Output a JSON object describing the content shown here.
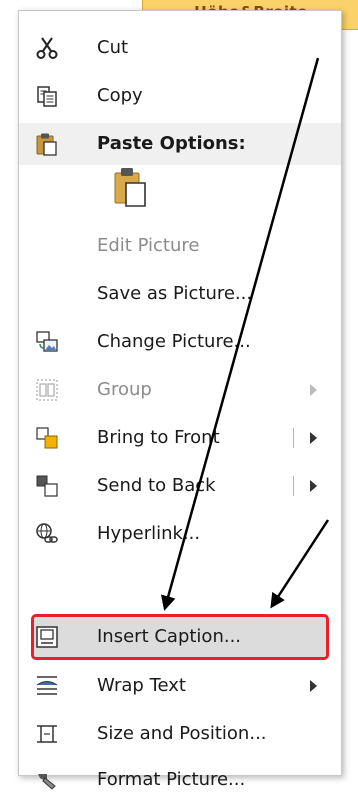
{
  "tab_label": "Höhe&Breite",
  "menu": {
    "cut": "Cut",
    "copy": "Copy",
    "paste_options": "Paste Options:",
    "edit_picture": "Edit Picture",
    "save_as_picture": "Save as Picture...",
    "change_picture": "Change Picture...",
    "group": "Group",
    "bring_to_front": "Bring to Front",
    "send_to_back": "Send to Back",
    "hyperlink": "Hyperlink...",
    "insert_caption": "Insert Caption...",
    "wrap_text": "Wrap Text",
    "size_and_position": "Size and Position...",
    "format_picture": "Format Picture..."
  },
  "colors": {
    "highlight_border": "#e8202a",
    "arrow": "#000000",
    "tab_background": "#fbd26a"
  },
  "icons": {
    "cut": "scissors-icon",
    "copy": "copy-icon",
    "paste": "clipboard-icon",
    "change_picture": "change-picture-icon",
    "group": "group-icon",
    "bring_to_front": "bring-front-icon",
    "send_to_back": "send-back-icon",
    "hyperlink": "hyperlink-icon",
    "insert_caption": "caption-icon",
    "wrap_text": "wrap-text-icon",
    "size_and_position": "size-position-icon",
    "format_picture": "format-picture-icon"
  }
}
